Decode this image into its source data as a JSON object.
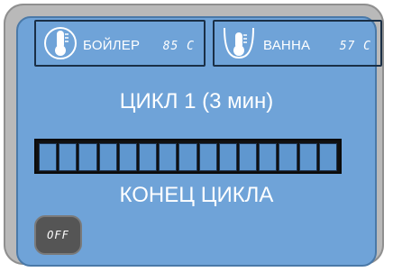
{
  "sensors": {
    "boiler": {
      "label": "БОЙЛЕР",
      "value": "85 C",
      "icon": "thermometer-icon"
    },
    "bath": {
      "label": "ВАННА",
      "value": "57 C",
      "icon": "bath-thermometer-icon"
    }
  },
  "cycle": {
    "title": "ЦИКЛ 1 (3 мин)",
    "status": "КОНЕЦ ЦИКЛА",
    "progress_fraction": 1.0,
    "segments_total": 15
  },
  "controls": {
    "off_label": "OFF"
  },
  "colors": {
    "screen_blue": "#6fa3d8",
    "progress_segment": "#5f97cf",
    "progress_background": "#111111",
    "text": "#ffffff",
    "off_button": "#555555"
  }
}
